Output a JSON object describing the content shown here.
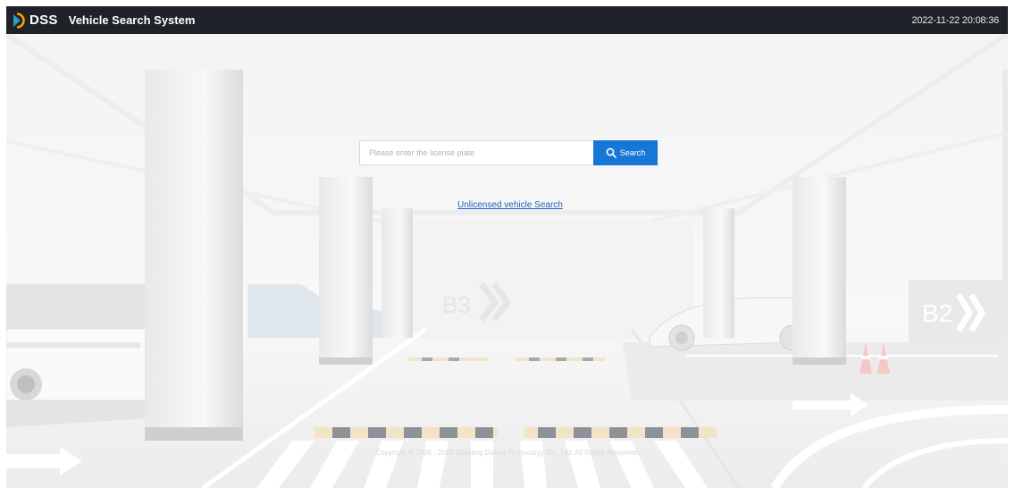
{
  "header": {
    "logo_text": "DSS",
    "title": "Vehicle Search System",
    "datetime": "2022-11-22 20:08:36"
  },
  "search": {
    "placeholder": "Please enter the license plate",
    "button_label": "Search"
  },
  "unlicensed_link": "Unlicensed vehicle Search",
  "scene": {
    "sign_b3": "B3",
    "sign_b2": "B2"
  },
  "footer": {
    "copyright": "Copyright © 1996 - 2022 Zhejiang Dahua Technology Co., Ltd. All Rights Reserved."
  },
  "colors": {
    "header_bg": "#1f2229",
    "accent": "#1677d6",
    "link": "#1a64b8"
  }
}
